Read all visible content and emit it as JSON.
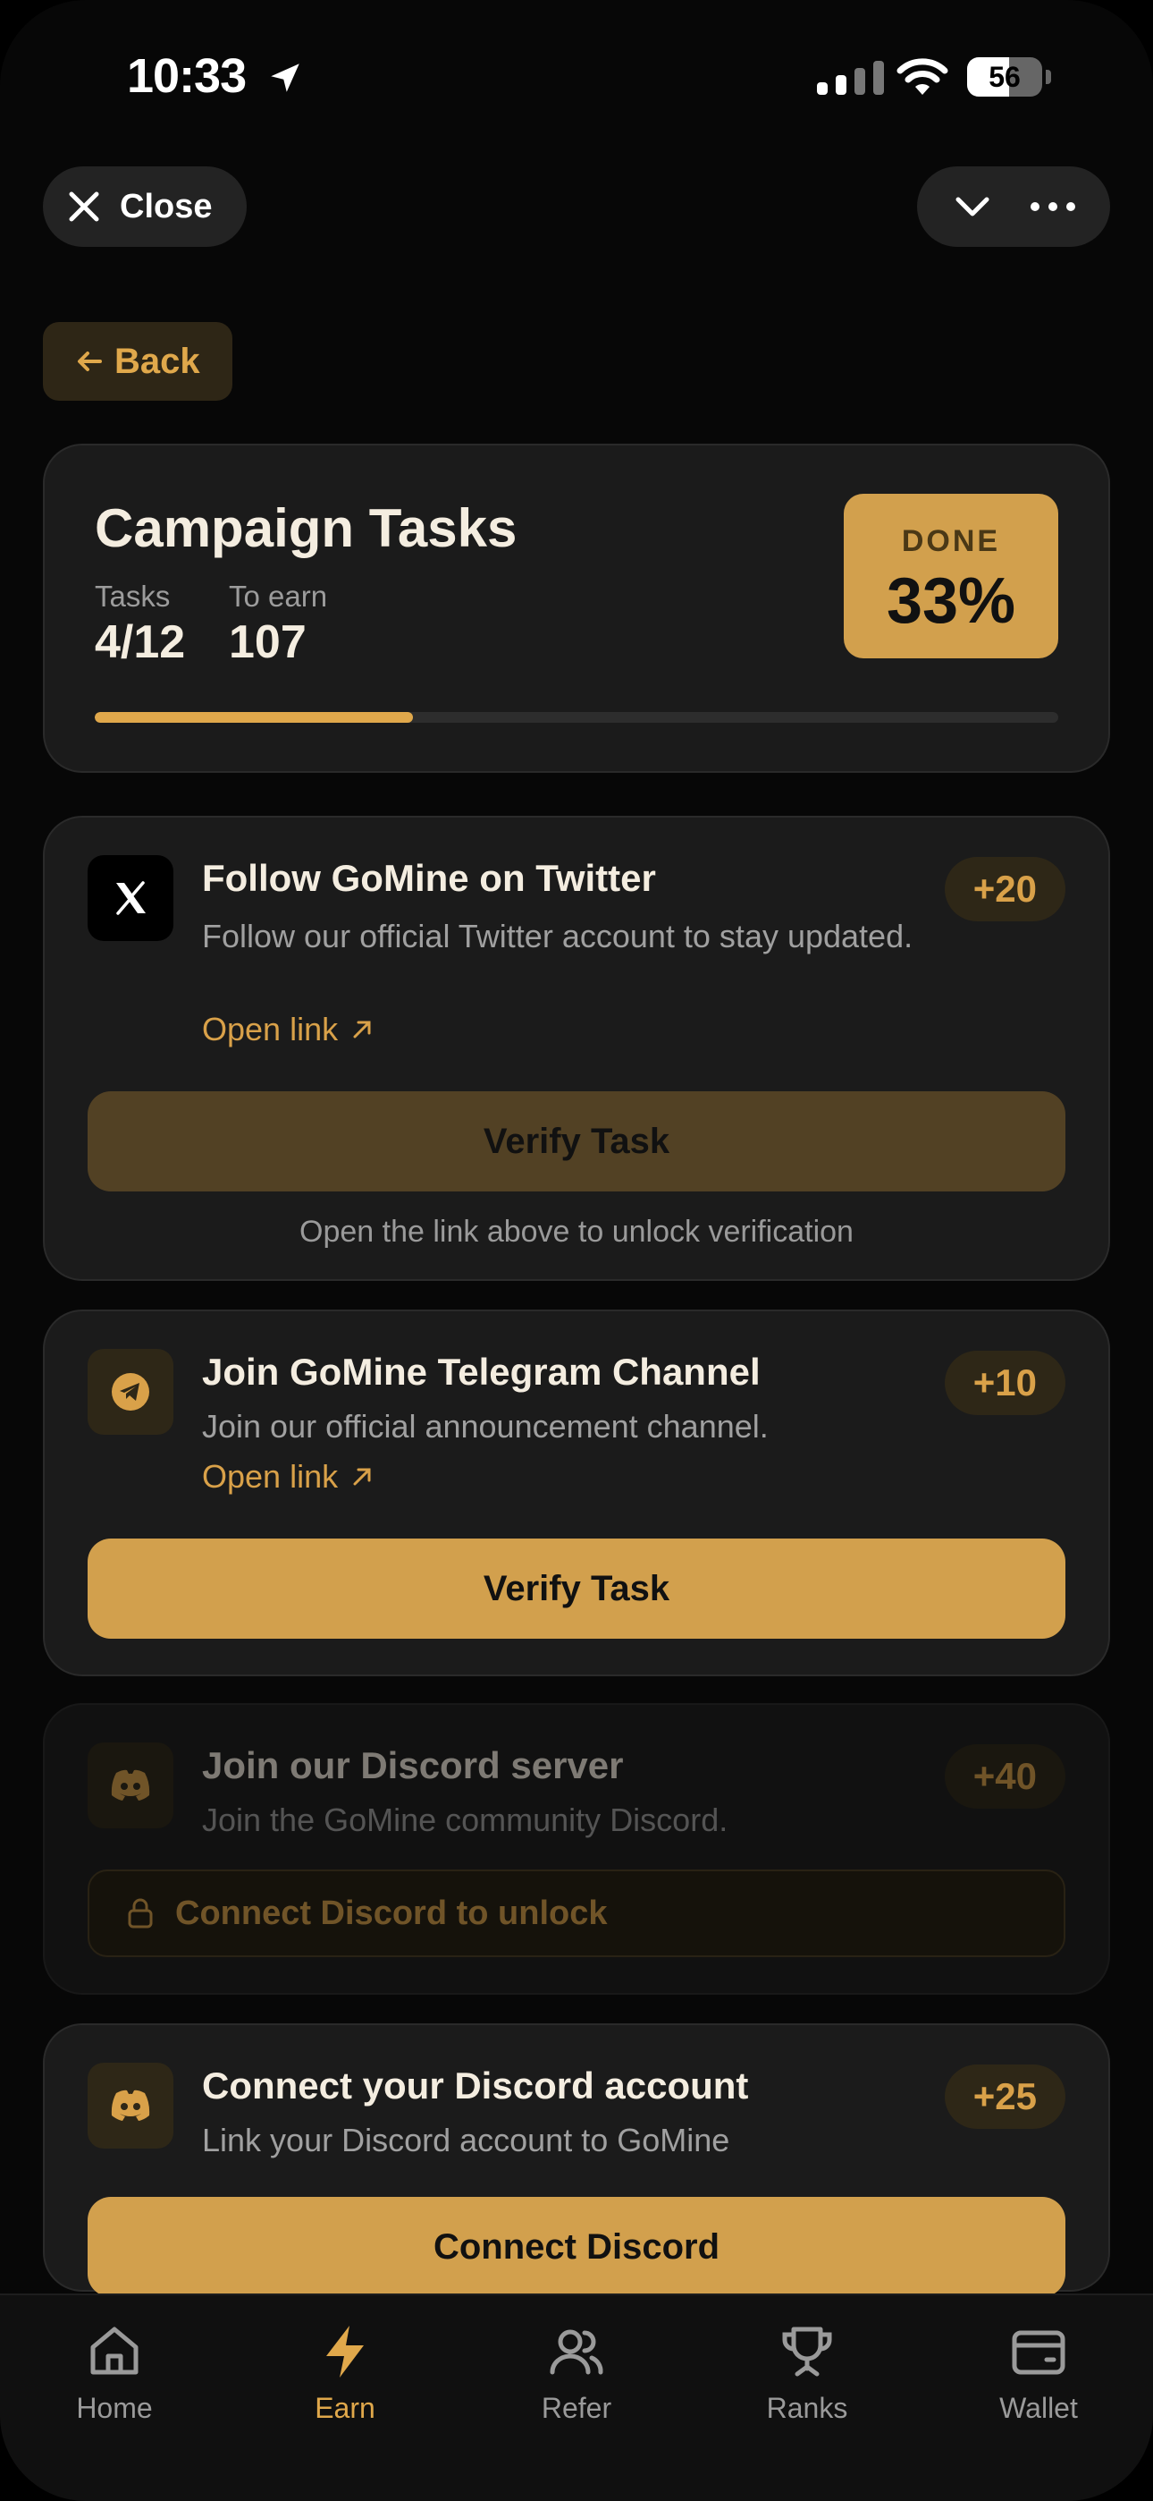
{
  "status_bar": {
    "time": "10:33",
    "battery": "56"
  },
  "top_bar": {
    "close_label": "Close"
  },
  "back_label": "Back",
  "campaign": {
    "title": "Campaign Tasks",
    "tasks_label": "Tasks",
    "tasks_value": "4/12",
    "earn_label": "To earn",
    "earn_value": "107",
    "done_label": "DONE",
    "done_value": "33%",
    "progress_fraction": 0.33
  },
  "tasks": [
    {
      "title": "Follow GoMine on Twitter",
      "description": "Follow our official Twitter account to stay updated.",
      "link": "Open link",
      "reward": "+20",
      "button": "Verify Task",
      "hint": "Open the link above to unlock verification",
      "icon": "x-logo-icon"
    },
    {
      "title": "Join GoMine Telegram Channel",
      "description": "Join our official announcement channel.",
      "link": "Open link",
      "reward": "+10",
      "button": "Verify Task",
      "icon": "telegram-icon"
    },
    {
      "title": "Join our Discord server",
      "description": "Join the GoMine community Discord.",
      "reward": "+40",
      "locked_label": "Connect Discord to unlock",
      "icon": "discord-icon"
    },
    {
      "title": "Connect your Discord account",
      "description": "Link your Discord account to GoMine",
      "reward": "+25",
      "button": "Connect Discord",
      "icon": "discord-icon"
    }
  ],
  "nav": [
    {
      "label": "Home",
      "icon": "home-icon"
    },
    {
      "label": "Earn",
      "icon": "lightning-icon",
      "active": true
    },
    {
      "label": "Refer",
      "icon": "users-icon"
    },
    {
      "label": "Ranks",
      "icon": "trophy-icon"
    },
    {
      "label": "Wallet",
      "icon": "wallet-icon"
    }
  ],
  "colors": {
    "accent": "#d2a04d",
    "background": "#070707",
    "card": "#1b1b1b"
  }
}
